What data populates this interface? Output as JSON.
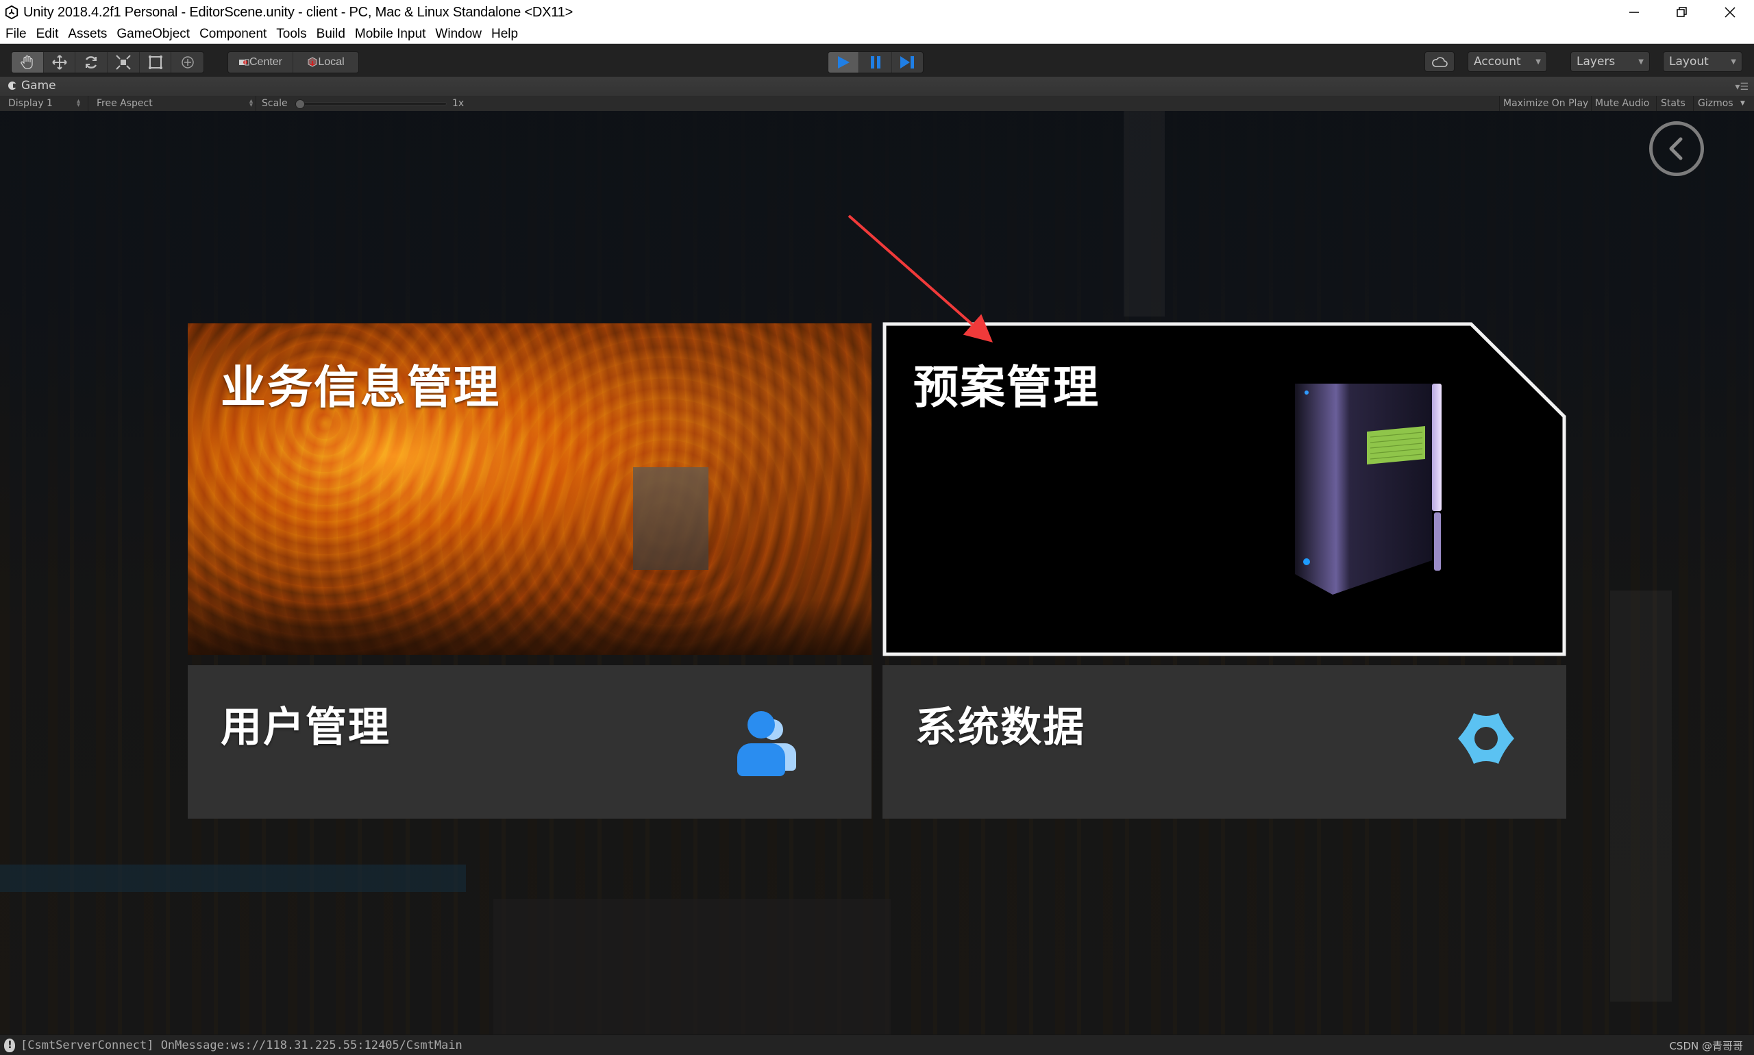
{
  "window": {
    "title": "Unity 2018.4.2f1 Personal - EditorScene.unity - client - PC, Mac & Linux Standalone <DX11>",
    "controls": [
      "minimize-icon",
      "restore-icon",
      "close-icon"
    ]
  },
  "menu": {
    "items": [
      "File",
      "Edit",
      "Assets",
      "GameObject",
      "Component",
      "Tools",
      "Build",
      "Mobile Input",
      "Window",
      "Help"
    ]
  },
  "toolbar": {
    "transform_tools": [
      "hand-tool",
      "move-tool",
      "rotate-tool",
      "scale-tool",
      "rect-tool",
      "transform-tool"
    ],
    "pivot_mode": "Center",
    "pivot_rotation": "Local",
    "playback": [
      "play",
      "pause",
      "step"
    ],
    "playback_color": "#1f7fe6",
    "account_label": "Account",
    "layers_label": "Layers",
    "layout_label": "Layout"
  },
  "game_panel": {
    "tab_label": "Game",
    "display": "Display 1",
    "aspect": "Free Aspect",
    "scale_label": "Scale",
    "scale_value": "1x",
    "scale_slider_fraction": 0.0,
    "maximize_on_play": "Maximize On Play",
    "mute_audio": "Mute Audio",
    "stats": "Stats",
    "gizmos": "Gizmos"
  },
  "game_view": {
    "cards": {
      "business": {
        "title": "业务信息管理"
      },
      "plan": {
        "title": "预案管理"
      },
      "user": {
        "title": "用户管理",
        "icon": "users-icon",
        "icon_color": "#2a8df0"
      },
      "sysdata": {
        "title": "系统数据",
        "icon": "gear-icon",
        "icon_color": "#5bc2f2"
      }
    },
    "annotation": "red arrow pointing at 预案管理 card",
    "annotation_color": "#f03a3a"
  },
  "statusbar": {
    "message": "[CsmtServerConnect] OnMessage:ws://118.31.225.55:12405/CsmtMain",
    "watermark": "CSDN @青哥哥"
  }
}
